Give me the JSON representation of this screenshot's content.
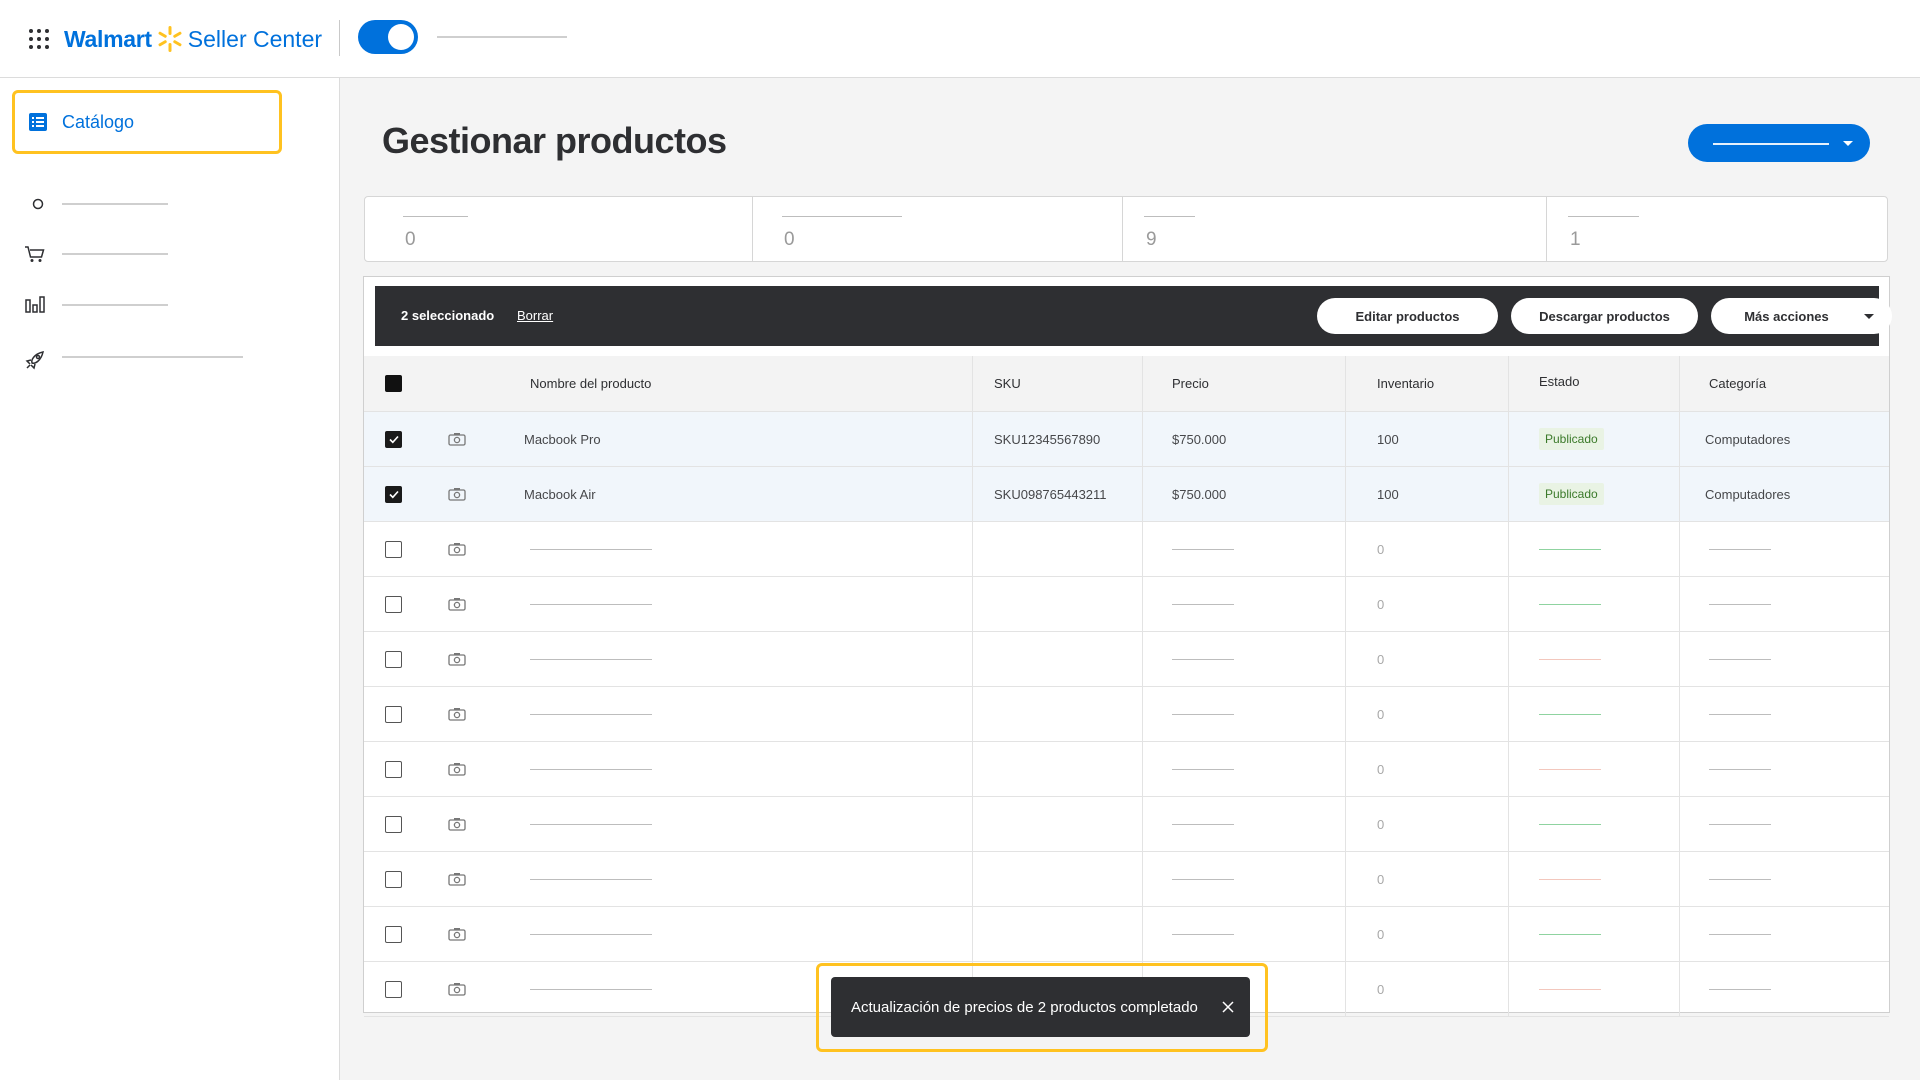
{
  "header": {
    "brand": "Walmart",
    "product": "Seller Center",
    "colors": {
      "brand_blue": "#0071dc",
      "spark_yellow": "#ffc220"
    }
  },
  "sidebar": {
    "items": [
      {
        "label": "Catálogo",
        "icon": "catalog-list-icon",
        "active": true
      },
      {
        "label": "",
        "icon": "circle-icon"
      },
      {
        "label": "",
        "icon": "shopping-cart-icon"
      },
      {
        "label": "",
        "icon": "bar-chart-icon"
      },
      {
        "label": "",
        "icon": "rocket-icon"
      }
    ]
  },
  "main": {
    "title": "Gestionar productos",
    "stats": [
      {
        "value": "0"
      },
      {
        "value": "0"
      },
      {
        "value": "9"
      },
      {
        "value": "1"
      }
    ],
    "action_bar": {
      "selected_count": "2 seleccionado",
      "clear": "Borrar",
      "edit": "Editar productos",
      "download": "Descargar productos",
      "more": "Más acciones"
    },
    "table": {
      "columns": [
        "Nombre del producto",
        "SKU",
        "Precio",
        "Inventario",
        "Estado",
        "Categoría"
      ],
      "rows": [
        {
          "selected": true,
          "name": "Macbook Pro",
          "sku": "SKU12345567890",
          "price": "$750.000",
          "inventory": "100",
          "status": "Publicado",
          "category": "Computadores"
        },
        {
          "selected": true,
          "name": "Macbook Air",
          "sku": "SKU098765443211",
          "price": "$750.000",
          "inventory": "100",
          "status": "Publicado",
          "category": "Computadores"
        },
        {
          "selected": false,
          "inventory": "0",
          "status_color": "#8fd3a0"
        },
        {
          "selected": false,
          "inventory": "0",
          "status_color": "#8fd3a0"
        },
        {
          "selected": false,
          "inventory": "0",
          "status_color": "#f3c7bd"
        },
        {
          "selected": false,
          "inventory": "0",
          "status_color": "#8fd3a0"
        },
        {
          "selected": false,
          "inventory": "0",
          "status_color": "#f3c7bd"
        },
        {
          "selected": false,
          "inventory": "0",
          "status_color": "#8fd3a0"
        },
        {
          "selected": false,
          "inventory": "0",
          "status_color": "#f3c7bd"
        },
        {
          "selected": false,
          "inventory": "0",
          "status_color": "#8fd3a0"
        },
        {
          "selected": false,
          "inventory": "0",
          "status_color": "#f3c7bd"
        }
      ]
    }
  },
  "toast": {
    "message": "Actualización de precios de 2 productos completado"
  }
}
